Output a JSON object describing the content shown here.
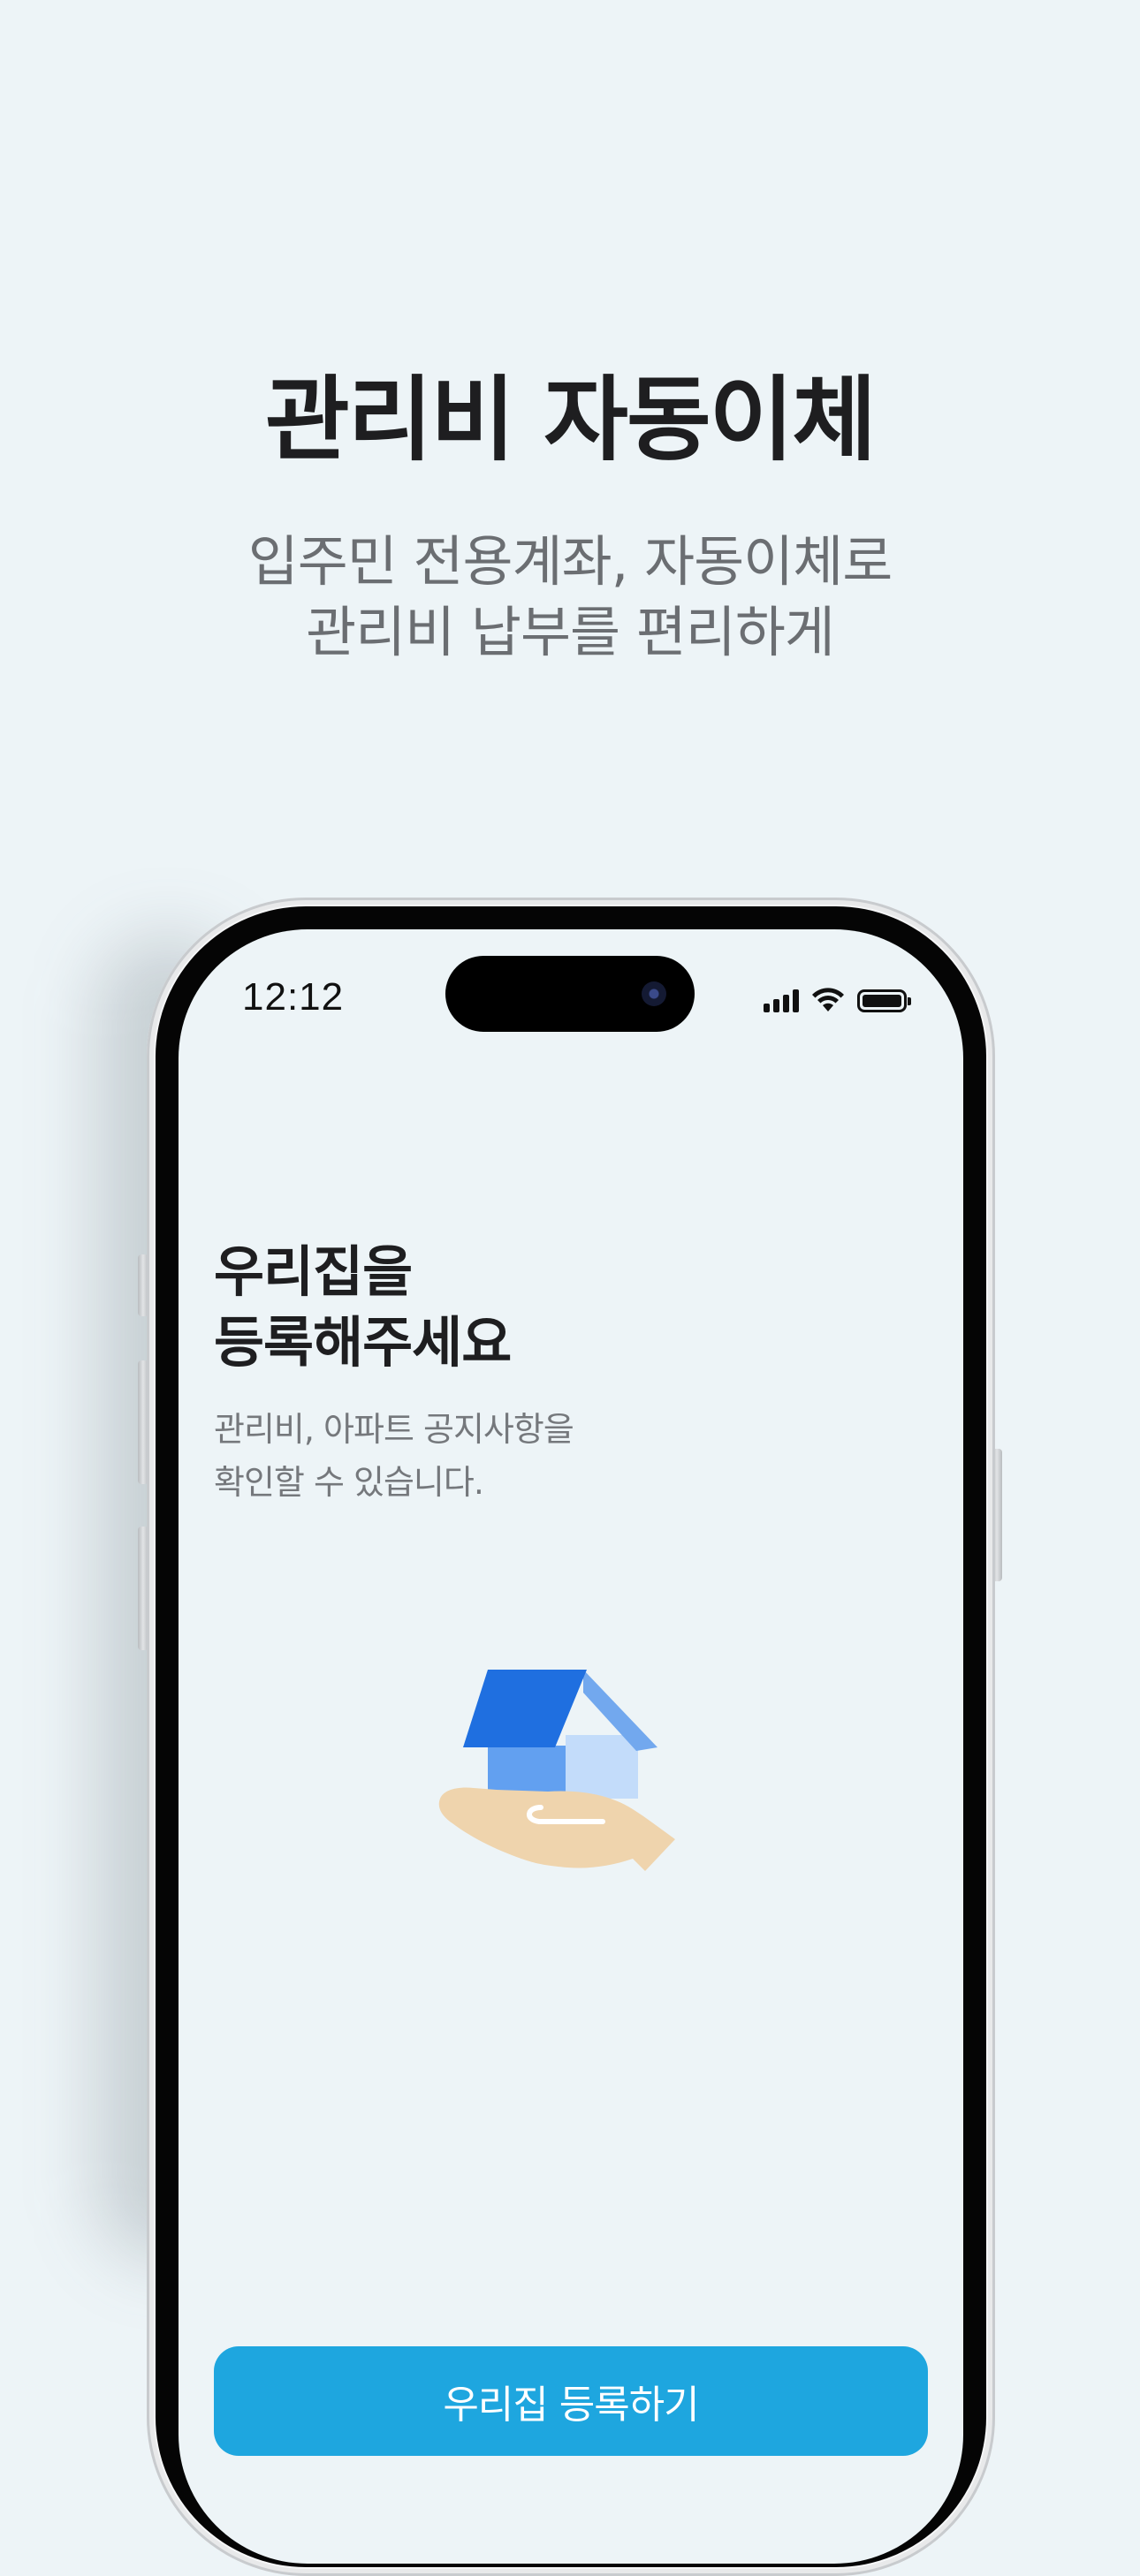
{
  "promo": {
    "headline": "관리비 자동이체",
    "subline_1": "입주민 전용계좌, 자동이체로",
    "subline_2": "관리비 납부를 편리하게"
  },
  "status_bar": {
    "time": "12:12"
  },
  "screen": {
    "title_1": "우리집을",
    "title_2": "등록해주세요",
    "desc_1": "관리비, 아파트 공지사항을",
    "desc_2": "확인할 수 있습니다.",
    "illustration_icon": "house-in-hand-icon",
    "cta_label": "우리집 등록하기"
  },
  "colors": {
    "background": "#edf4f7",
    "cta": "#1ea6df",
    "house_roof": "#1f6fe0",
    "house_body": "#62a0f0",
    "hand": "#efd4ad"
  }
}
